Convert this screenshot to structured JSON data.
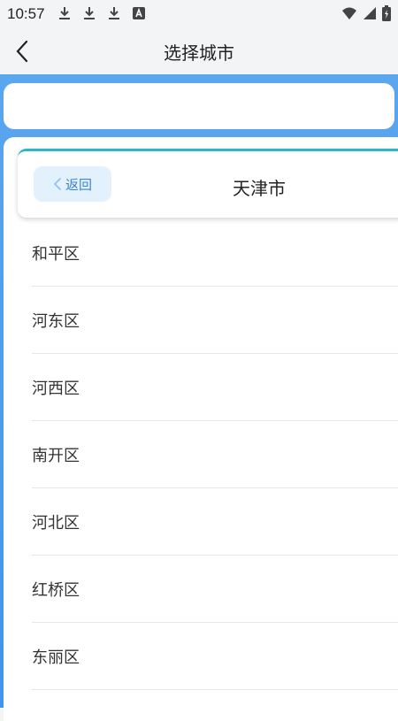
{
  "status_bar": {
    "time": "10:57",
    "icons": [
      "download-icon",
      "download-icon",
      "download-icon",
      "a-badge-icon",
      "wifi-icon",
      "signal-icon",
      "battery-icon"
    ]
  },
  "header": {
    "title": "选择城市",
    "back_icon": "chevron-left-icon"
  },
  "city_panel": {
    "back_label": "返回",
    "city_name": "天津市"
  },
  "districts": [
    {
      "name": "和平区"
    },
    {
      "name": "河东区"
    },
    {
      "name": "河西区"
    },
    {
      "name": "南开区"
    },
    {
      "name": "河北区"
    },
    {
      "name": "红桥区"
    },
    {
      "name": "东丽区"
    }
  ],
  "colors": {
    "accent_blue": "#3f95ea",
    "back_button_bg": "#e3f1fc",
    "back_button_text": "#3a86d0",
    "card_top_border": "#2ab8c9"
  }
}
